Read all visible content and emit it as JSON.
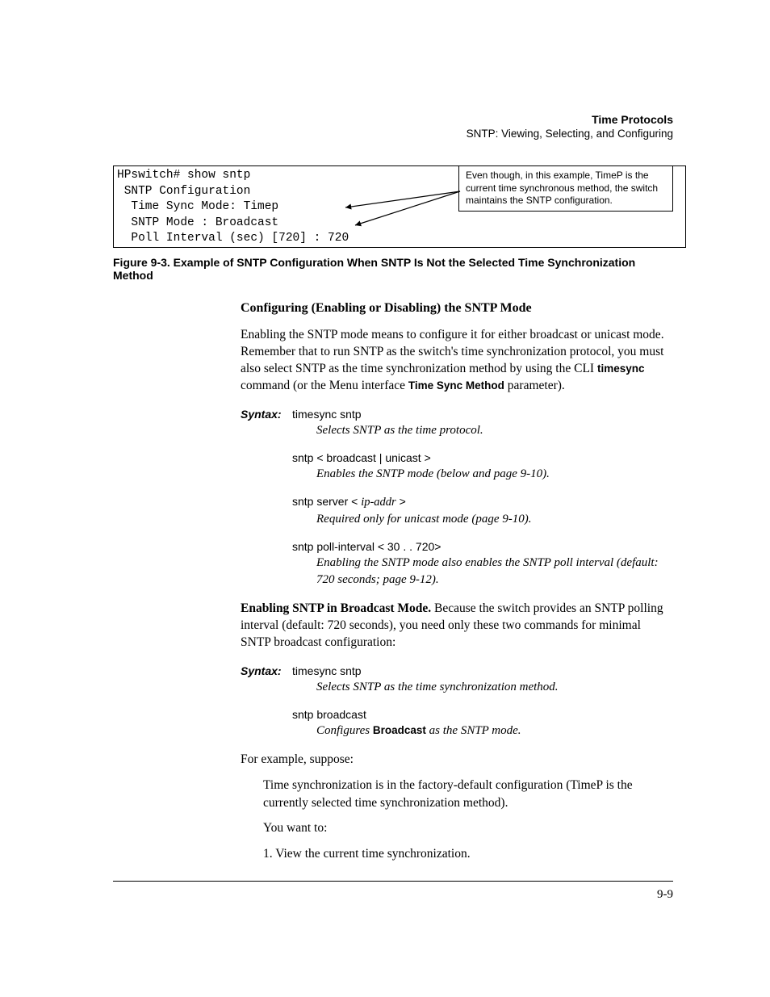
{
  "header": {
    "title": "Time Protocols",
    "subtitle": "SNTP: Viewing, Selecting, and Configuring"
  },
  "terminal": {
    "l1": "HPswitch# show sntp",
    "l2": " SNTP Configuration",
    "l3": "  Time Sync Mode: Timep",
    "l4": "  SNTP Mode : Broadcast",
    "l5": "  Poll Interval (sec) [720] : 720"
  },
  "callout": "Even though, in this example, TimeP is the current time synchronous method,  the switch maintains the SNTP configuration.",
  "figcaption": "Figure 9-3.   Example of SNTP Configuration When SNTP Is Not the Selected Time Synchronization Method",
  "section1": {
    "title": "Configuring (Enabling or Disabling) the SNTP Mode",
    "para_a": "Enabling the SNTP mode means to configure it for either broadcast or unicast mode. Remember that to run SNTP as the switch's time synchronization protocol, you must also select SNTP as the time synchronization method by using the CLI ",
    "para_b": " command (or the Menu interface ",
    "para_c": " parameter).",
    "cli_cmd": "timesync",
    "menu_cmd": "Time Sync Method"
  },
  "syntax_label": "Syntax:",
  "syn1": {
    "cmd1": "timesync sntp",
    "desc1": "Selects SNTP as the time protocol.",
    "cmd2": "sntp < broadcast | unicast >",
    "desc2": "Enables the SNTP mode (below and page 9-10).",
    "cmd3a": "sntp server < ",
    "cmd3b": "ip-addr",
    "cmd3c": " >",
    "desc3": "Required only for unicast mode (page 9-10).",
    "cmd4": "sntp poll-interval  < 30 . . 720>",
    "desc4": "Enabling the SNTP mode also enables the SNTP poll interval (default: 720 seconds; page 9-12)."
  },
  "section2": {
    "runin": "Enabling SNTP in Broadcast Mode.",
    "rest": " Because the switch provides an SNTP polling interval (default: 720 seconds), you need only these two commands for minimal SNTP broadcast configuration:"
  },
  "syn2": {
    "cmd1": "timesync sntp",
    "desc1": "Selects SNTP as the time synchronization method.",
    "cmd2": "sntp broadcast",
    "desc2a": "Configures ",
    "desc2b": "Broadcast",
    "desc2c": " as the SNTP mode."
  },
  "example": {
    "lead": "For example, suppose:",
    "p1": "Time synchronization is in the factory-default configuration (TimeP is the currently selected time synchronization method).",
    "p2": "You want to:",
    "p3": "1. View the current time synchronization."
  },
  "pagenum": "9-9"
}
